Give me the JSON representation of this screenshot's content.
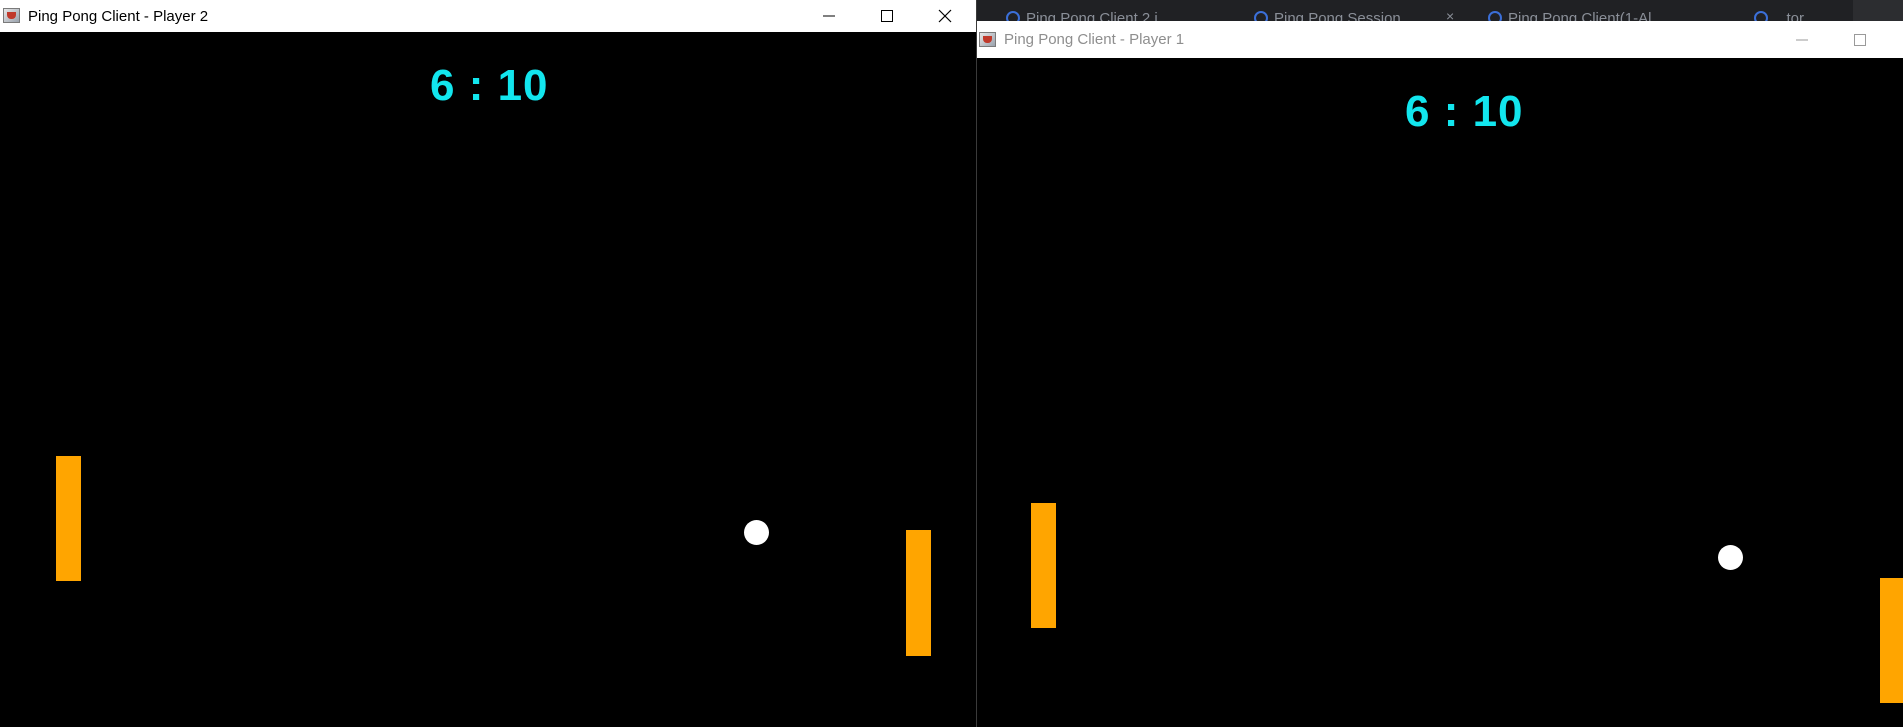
{
  "background": {
    "tabs": [
      {
        "label": "Ping Pong Client 2 i"
      },
      {
        "label": "Ping Pong Session"
      },
      {
        "label": "Ping Pong Client(1-Al..."
      },
      {
        "label": "...tor"
      }
    ],
    "close_glyph": "×"
  },
  "window_player2": {
    "title": "Ping Pong Client - Player 2",
    "score": "6 : 10",
    "icon": "java-app-icon",
    "controls": [
      "minimize-icon",
      "maximize-icon",
      "close-icon"
    ],
    "active": true
  },
  "window_player1": {
    "title": "Ping Pong Client - Player 1",
    "score": "6 : 10",
    "icon": "java-app-icon",
    "controls": [
      "minimize-icon",
      "maximize-icon"
    ],
    "active": false
  },
  "colors": {
    "score": "#12e6ee",
    "paddle": "#ffa500",
    "ball": "#ffffff",
    "field": "#000000"
  }
}
